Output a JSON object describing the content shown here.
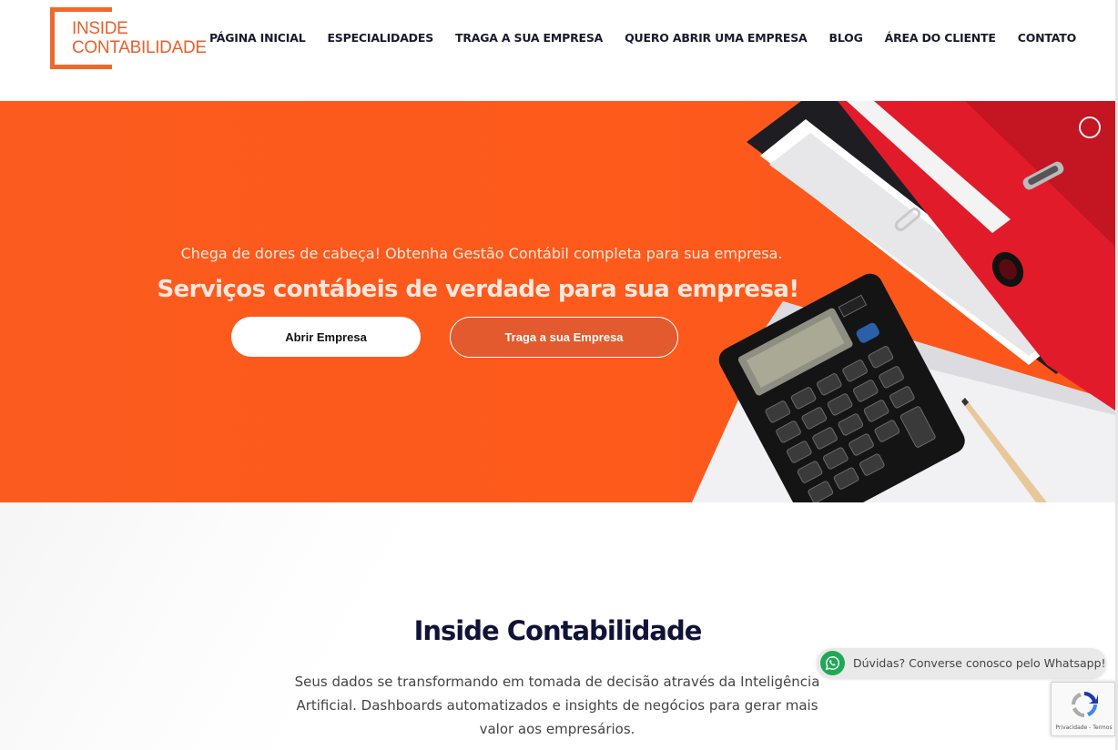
{
  "header": {
    "logo": {
      "line1": "INSIDE",
      "line2": "CONTABILIDADE"
    },
    "nav": [
      {
        "label": "PÁGINA INICIAL"
      },
      {
        "label": "ESPECIALIDADES"
      },
      {
        "label": "TRAGA A SUA EMPRESA"
      },
      {
        "label": "QUERO ABRIR UMA EMPRESA"
      },
      {
        "label": "BLOG"
      },
      {
        "label": "ÁREA DO CLIENTE"
      },
      {
        "label": "CONTATO"
      }
    ]
  },
  "hero": {
    "subtitle": "Chega de dores de cabeça! Obtenha Gestão Contábil completa para sua empresa.",
    "title": "Serviços contábeis de verdade para sua empresa!",
    "primary_button": "Abrir Empresa",
    "secondary_button": "Traga a sua Empresa",
    "background_color": "#fb5b1e"
  },
  "about": {
    "title": "Inside Contabilidade",
    "text": "Seus dados se transformando em tomada de decisão através da Inteligência Artificial. Dashboards automatizados e insights de negócios para gerar mais valor aos empresários."
  },
  "whatsapp": {
    "label": "Dúvidas? Converse conosco pelo Whatsapp!",
    "color": "#1fa856"
  },
  "recaptcha": {
    "label": "Privacidade - Termos"
  },
  "colors": {
    "brand": "#ee6a2b",
    "dark_text": "#111238"
  }
}
